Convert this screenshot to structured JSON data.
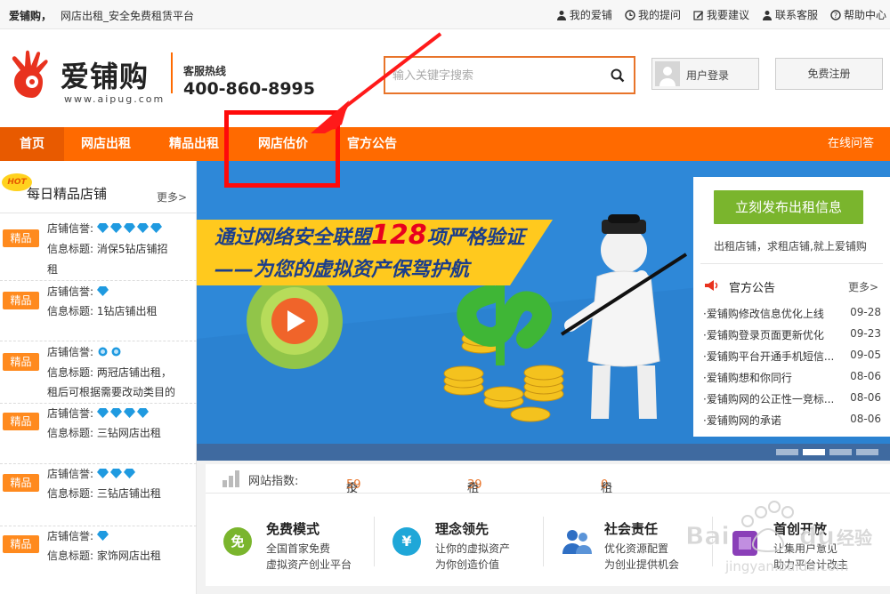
{
  "topbar": {
    "brand": "爱铺购，",
    "slogan": "网店出租_安全免费租赁平台",
    "links": [
      "我的爱铺",
      "我的提问",
      "我要建议",
      "联系客服",
      "帮助中心"
    ]
  },
  "header": {
    "logo_text": "爱铺购",
    "logo_url": "www.aipug.com",
    "hotline_label": "客服热线",
    "hotline_number": "400-860-8995",
    "search_placeholder": "输入关键字搜索",
    "login_label": "用户登录",
    "register_label": "免费注册"
  },
  "nav": {
    "items": [
      "首页",
      "网店出租",
      "精品出租",
      "网店估价",
      "官方公告"
    ],
    "right": "在线问答"
  },
  "left_panel": {
    "hot": "HOT",
    "title": "每日精品店铺",
    "more": "更多>",
    "shops": [
      {
        "badge": "精品",
        "rep_label": "店铺信誉:",
        "rep": "5 blue diamonds",
        "title_label": "信息标题:",
        "title": "消保5钻店铺招",
        "title2": "租"
      },
      {
        "badge": "精品",
        "rep_label": "店铺信誉:",
        "rep": "1 blue diamond",
        "title_label": "信息标题:",
        "title": "1钻店铺出租",
        "title2": ""
      },
      {
        "badge": "精品",
        "rep_label": "店铺信誉:",
        "rep": "2 blue crowns",
        "title_label": "信息标题:",
        "title": "两冠店铺出租，",
        "title2": "租后可根据需要改动类目的"
      },
      {
        "badge": "精品",
        "rep_label": "店铺信誉:",
        "rep": "4 blue diamonds",
        "title_label": "信息标题:",
        "title": "三钻网店出租",
        "title2": ""
      },
      {
        "badge": "精品",
        "rep_label": "店铺信誉:",
        "rep": "3 blue diamonds",
        "title_label": "信息标题:",
        "title": "三钻店铺出租",
        "title2": ""
      },
      {
        "badge": "精品",
        "rep_label": "店铺信誉:",
        "rep": "1 blue diamond",
        "title_label": "信息标题:",
        "title": "家饰网店出租",
        "title2": ""
      }
    ]
  },
  "banner": {
    "line1_a": "通过网络安全联盟",
    "line1_num": "128",
    "line1_b": "项严格验证",
    "line2": "——为您的虚拟资产保驾护航"
  },
  "side": {
    "publish_label": "立刻发布出租信息",
    "subtitle": "出租店铺，求租店铺,就上爱铺购",
    "news_title": "官方公告",
    "news_more": "更多>",
    "news": [
      {
        "text": "·爱铺购修改信息优化上线",
        "date": "09-28"
      },
      {
        "text": "·爱铺购登录页面更新优化",
        "date": "09-23"
      },
      {
        "text": "·爱铺购平台开通手机短信...",
        "date": "09-05"
      },
      {
        "text": "·爱铺购想和你同行",
        "date": "08-06"
      },
      {
        "text": "·爱铺购网的公正性一竞标...",
        "date": "08-06"
      },
      {
        "text": "·爱铺购网的承诺",
        "date": "08-06"
      }
    ]
  },
  "stats": {
    "label": "网站指数:",
    "bidding_label": "投标中:",
    "bidding": "59",
    "renting_label": "租赁开始:",
    "renting": "39",
    "done_label": "租赁完成:",
    "done": "0",
    "unit": "个"
  },
  "features": [
    {
      "icon": "免",
      "title": "免费模式",
      "line1": "全国首家免费",
      "line2": "虚拟资产创业平台",
      "color": "#7ab52d"
    },
    {
      "icon": "¥",
      "title": "理念领先",
      "line1": "让你的虚拟资产",
      "line2": "为你创造价值",
      "color": "#1fa7d8"
    },
    {
      "icon": "",
      "title": "社会责任",
      "line1": "优化资源配置",
      "line2": "为创业提供机会",
      "color": "#2f6fc4"
    },
    {
      "icon": "",
      "title": "首创开放",
      "line1": "让集用户意见",
      "line2": "助力平台计改主",
      "color": "#8a3fb8"
    }
  ],
  "watermark": {
    "text": "Bai",
    "text2": "du",
    "text3": "经验",
    "url": "jingyan.baidu.com"
  }
}
